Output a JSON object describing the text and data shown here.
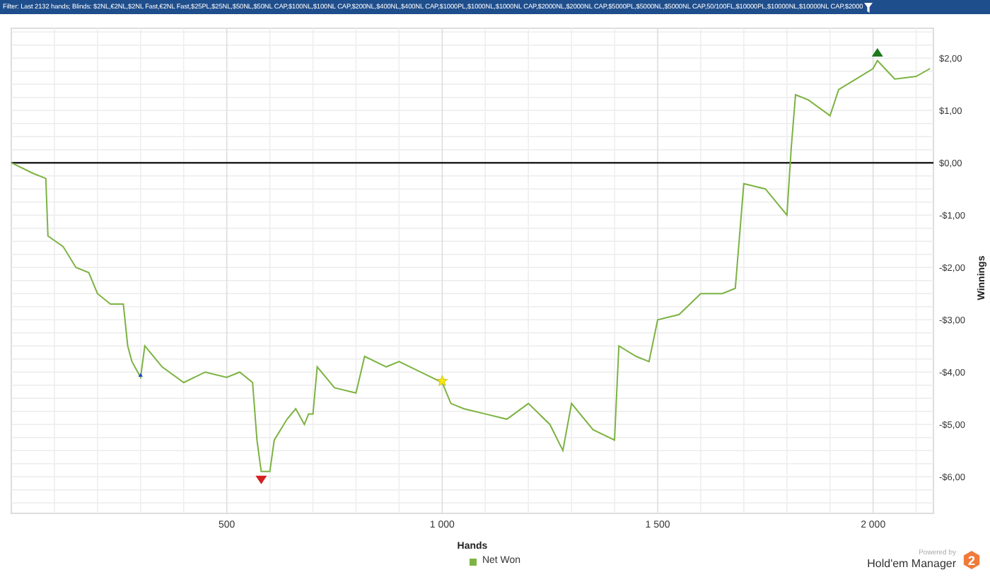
{
  "filter_bar": {
    "text": "Filter: Last 2132 hands; Blinds: $2NL,€2NL,$2NL Fast,€2NL Fast,$25PL,$25NL,$50NL,$50NL CAP,$100NL,$100NL CAP,$200NL,$400NL,$400NL CAP,$1000PL,$1000NL,$1000NL CAP,$2000NL,$2000NL CAP,$5000PL,$5000NL,$5000NL CAP,50/100FL,$10000PL,$10000NL,$10000NL CAP,$2000"
  },
  "chart": {
    "chart_data": {
      "type": "line",
      "xlabel": "Hands",
      "ylabel": "Winnings",
      "x": [
        0,
        50,
        80,
        85,
        120,
        150,
        180,
        200,
        230,
        260,
        270,
        280,
        300,
        310,
        350,
        400,
        450,
        500,
        530,
        560,
        570,
        580,
        600,
        610,
        640,
        660,
        680,
        690,
        700,
        710,
        750,
        800,
        820,
        870,
        900,
        950,
        1000,
        1020,
        1050,
        1100,
        1150,
        1200,
        1250,
        1280,
        1300,
        1350,
        1400,
        1410,
        1450,
        1480,
        1500,
        1550,
        1600,
        1650,
        1680,
        1700,
        1750,
        1800,
        1810,
        1820,
        1850,
        1900,
        1920,
        1960,
        2000,
        2010,
        2050,
        2100,
        2132
      ],
      "series": [
        {
          "name": "Net Won",
          "color": "#7cb342",
          "values": [
            0,
            -0.2,
            -0.3,
            -1.4,
            -1.6,
            -2.0,
            -2.1,
            -2.5,
            -2.7,
            -2.7,
            -3.5,
            -3.8,
            -4.1,
            -3.5,
            -3.9,
            -4.2,
            -4.0,
            -4.1,
            -4.0,
            -4.2,
            -5.3,
            -5.9,
            -5.9,
            -5.3,
            -4.9,
            -4.7,
            -5.0,
            -4.8,
            -4.8,
            -3.9,
            -4.3,
            -4.4,
            -3.7,
            -3.9,
            -3.8,
            -4.0,
            -4.2,
            -4.6,
            -4.7,
            -4.8,
            -4.9,
            -4.6,
            -5.0,
            -5.5,
            -4.6,
            -5.1,
            -5.3,
            -3.5,
            -3.7,
            -3.8,
            -3.0,
            -2.9,
            -2.5,
            -2.5,
            -2.4,
            -0.4,
            -0.5,
            -1.0,
            0.3,
            1.3,
            1.2,
            0.9,
            1.4,
            1.6,
            1.8,
            1.95,
            1.6,
            1.65,
            1.8
          ]
        }
      ],
      "xlim": [
        0,
        2140
      ],
      "ylim": [
        -6.7,
        2.57
      ],
      "xticks": [
        {
          "value": 500,
          "label": "500"
        },
        {
          "value": 1000,
          "label": "1 000"
        },
        {
          "value": 1500,
          "label": "1 500"
        },
        {
          "value": 2000,
          "label": "2 000"
        }
      ],
      "yticks": [
        {
          "value": 2,
          "label": "$2,00"
        },
        {
          "value": 1,
          "label": "$1,00"
        },
        {
          "value": 0,
          "label": "$0,00"
        },
        {
          "value": -1,
          "label": "-$1,00"
        },
        {
          "value": -2,
          "label": "-$2,00"
        },
        {
          "value": -3,
          "label": "-$3,00"
        },
        {
          "value": -4,
          "label": "-$4,00"
        },
        {
          "value": -5,
          "label": "-$5,00"
        },
        {
          "value": -6,
          "label": "-$6,00"
        }
      ],
      "grid": true
    },
    "markers": [
      {
        "kind": "max"
      },
      {
        "kind": "min"
      },
      {
        "kind": "star"
      },
      {
        "kind": "small"
      }
    ]
  },
  "branding": {
    "caption": "Powered by",
    "product": "Hold'em Manager",
    "logo_digit": "2"
  }
}
